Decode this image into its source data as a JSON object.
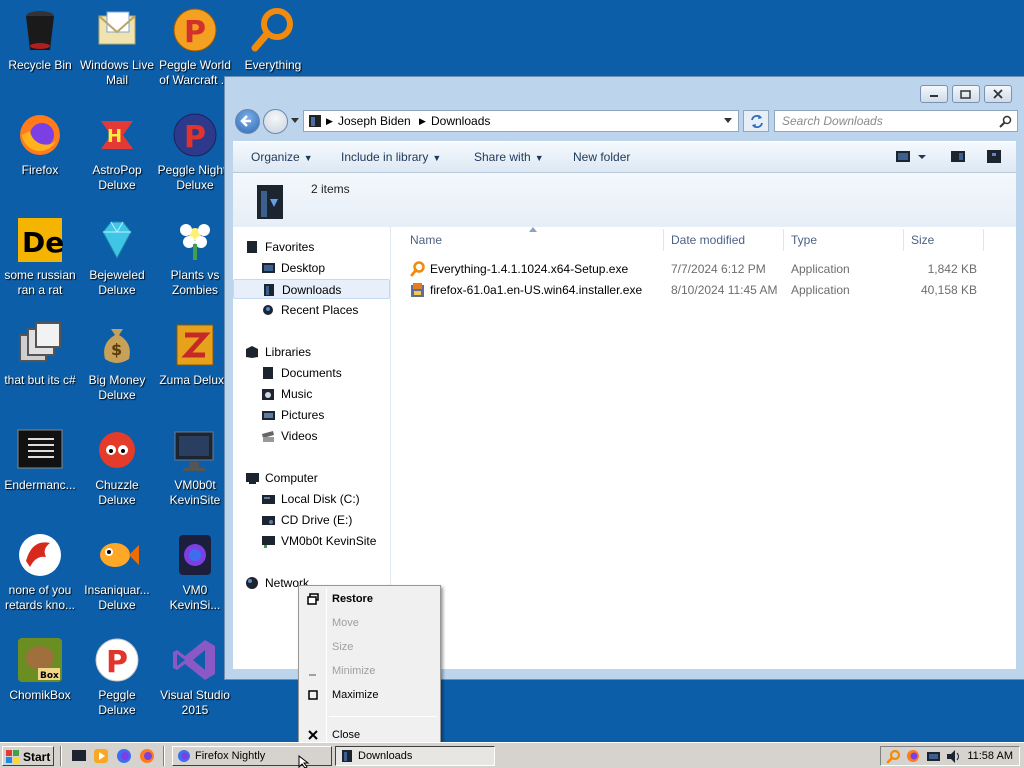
{
  "desktop": {
    "icons": [
      {
        "label": "Recycle Bin",
        "icon": "recycle-bin-icon"
      },
      {
        "label": "Windows Live Mail",
        "icon": "mail-icon"
      },
      {
        "label": "Peggle World of Warcraft ...",
        "icon": "peggle-icon"
      },
      {
        "label": "Everything",
        "icon": "magnifier-icon"
      },
      {
        "label": "Firefox",
        "icon": "firefox-icon"
      },
      {
        "label": "AstroPop Deluxe",
        "icon": "astropop-icon"
      },
      {
        "label": "Peggle Nights Deluxe",
        "icon": "peggle-icon"
      },
      {
        "label": "some russian ran a rat",
        "icon": "de-icon"
      },
      {
        "label": "Bejeweled Deluxe",
        "icon": "gem-icon"
      },
      {
        "label": "Plants vs Zombies",
        "icon": "flower-icon"
      },
      {
        "label": "that but its c#",
        "icon": "window-stack-icon"
      },
      {
        "label": "Big Money Deluxe",
        "icon": "money-bag-icon"
      },
      {
        "label": "Zuma Deluxe",
        "icon": "zuma-icon"
      },
      {
        "label": "Endermanc...",
        "icon": "terminal-icon"
      },
      {
        "label": "Chuzzle Deluxe",
        "icon": "chuzzle-icon"
      },
      {
        "label": "VM0b0t KevinSite",
        "icon": "monitor-icon"
      },
      {
        "label": "none of you retards kno...",
        "icon": "dragon-icon"
      },
      {
        "label": "Insaniquar... Deluxe",
        "icon": "fish-icon"
      },
      {
        "label": "VM0 KevinSi...",
        "icon": "firefox-dark-icon"
      },
      {
        "label": "ChomikBox",
        "icon": "hamster-icon"
      },
      {
        "label": "Peggle Deluxe",
        "icon": "peggle-icon"
      },
      {
        "label": "Visual Studio 2015",
        "icon": "visual-studio-icon"
      }
    ]
  },
  "explorer": {
    "breadcrumb": [
      "Joseph Biden",
      "Downloads"
    ],
    "search_placeholder": "Search Downloads",
    "toolbar": {
      "organize": "Organize",
      "include": "Include in library",
      "share": "Share with",
      "newfolder": "New folder"
    },
    "item_count": "2 items",
    "nav": {
      "favorites": "Favorites",
      "desktop": "Desktop",
      "downloads": "Downloads",
      "recent": "Recent Places",
      "libraries": "Libraries",
      "documents": "Documents",
      "music": "Music",
      "pictures": "Pictures",
      "videos": "Videos",
      "computer": "Computer",
      "localdisk": "Local Disk (C:)",
      "cddrive": "CD Drive (E:)",
      "vm": "VM0b0t KevinSite",
      "network": "Network"
    },
    "columns": {
      "name": "Name",
      "date": "Date modified",
      "type": "Type",
      "size": "Size"
    },
    "files": [
      {
        "name": "Everything-1.4.1.1024.x64-Setup.exe",
        "date": "7/7/2024 6:12 PM",
        "type": "Application",
        "size": "1,842 KB",
        "icon": "everything-icon"
      },
      {
        "name": "firefox-61.0a1.en-US.win64.installer.exe",
        "date": "8/10/2024 11:45 AM",
        "type": "Application",
        "size": "40,158 KB",
        "icon": "installer-icon"
      }
    ]
  },
  "context_menu": {
    "restore": "Restore",
    "move": "Move",
    "size": "Size",
    "minimize": "Minimize",
    "maximize": "Maximize",
    "close": "Close"
  },
  "taskbar": {
    "start": "Start",
    "tasks": [
      {
        "label": "Firefox Nightly",
        "active": false
      },
      {
        "label": "Downloads",
        "active": true
      }
    ],
    "clock": "11:58 AM"
  }
}
